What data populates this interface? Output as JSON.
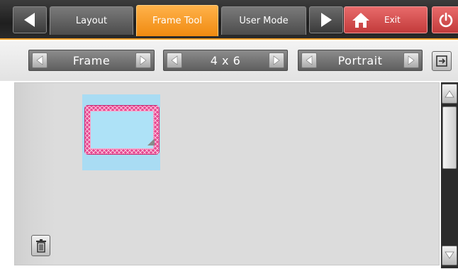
{
  "toolbar": {
    "tabs": [
      {
        "label": "Layout",
        "active": false
      },
      {
        "label": "Frame Tool",
        "active": true
      },
      {
        "label": "User Mode",
        "active": false
      }
    ],
    "exit_label": "Exit",
    "icons": {
      "back": "left-arrow-icon",
      "forward": "right-arrow-icon",
      "exit": "home-icon",
      "power": "power-icon"
    },
    "accent_color": "#f5a12a",
    "exit_color": "#d04848"
  },
  "selectors": {
    "type": {
      "value": "Frame"
    },
    "size": {
      "value": "4 x 6"
    },
    "orientation": {
      "value": "Portrait"
    },
    "export_icon": "export-icon"
  },
  "main": {
    "frame_thumbnail": {
      "border_color": "#e6458f",
      "background_color": "#a9dcf3",
      "selected": true
    },
    "trash_icon": "trash-icon"
  },
  "scrollbar": {
    "up_icon": "up-arrow-icon",
    "down_icon": "down-arrow-icon"
  }
}
